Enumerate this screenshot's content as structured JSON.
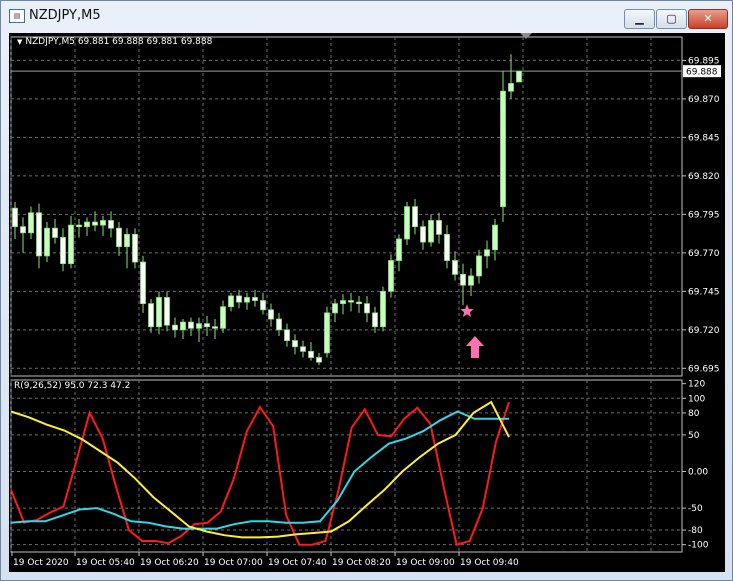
{
  "window": {
    "title": "NZDJPY,M5",
    "icon": "chart-window-icon",
    "controls": {
      "minimize": "▁",
      "maximize": "▢",
      "close": "✕"
    }
  },
  "main_chart": {
    "header": "NZDJPY,M5  69.881 69.888 69.881 69.888",
    "price_labels": [
      "69.895",
      "69.870",
      "69.845",
      "69.820",
      "69.795",
      "69.770",
      "69.745",
      "69.720",
      "69.695"
    ],
    "price_values": [
      69.895,
      69.87,
      69.845,
      69.82,
      69.795,
      69.77,
      69.745,
      69.72,
      69.695
    ],
    "current_price": "69.888",
    "current_price_value": 69.888,
    "colors": {
      "background": "#000000",
      "grid": "#6b6b6b",
      "bull_candle": "#c8ffc0",
      "bear_candle": "#ffffff",
      "wick": "#8ddf7a",
      "arrow": "#ff70b0",
      "star": "#ff70b0"
    },
    "candles": [
      [
        69.799,
        69.803,
        69.779,
        69.787
      ],
      [
        69.787,
        69.793,
        69.77,
        69.783
      ],
      [
        69.783,
        69.8,
        69.779,
        69.796
      ],
      [
        69.796,
        69.802,
        69.76,
        69.768
      ],
      [
        69.768,
        69.79,
        69.764,
        69.786
      ],
      [
        69.786,
        69.792,
        69.776,
        69.78
      ],
      [
        69.78,
        69.786,
        69.758,
        69.763
      ],
      [
        69.763,
        69.794,
        69.76,
        69.788
      ],
      [
        69.788,
        69.792,
        69.78,
        69.787
      ],
      [
        69.787,
        69.793,
        69.781,
        69.79
      ],
      [
        69.79,
        69.797,
        69.784,
        69.788
      ],
      [
        69.788,
        69.794,
        69.781,
        69.791
      ],
      [
        69.791,
        69.797,
        69.78,
        69.786
      ],
      [
        69.786,
        69.79,
        69.768,
        69.774
      ],
      [
        69.774,
        69.786,
        69.76,
        69.782
      ],
      [
        69.782,
        69.786,
        69.76,
        69.764
      ],
      [
        69.764,
        69.768,
        69.731,
        69.737
      ],
      [
        69.737,
        69.74,
        69.718,
        69.722
      ],
      [
        69.722,
        69.745,
        69.717,
        69.741
      ],
      [
        69.741,
        69.745,
        69.719,
        69.723
      ],
      [
        69.723,
        69.728,
        69.715,
        69.72
      ],
      [
        69.72,
        69.727,
        69.714,
        69.725
      ],
      [
        69.725,
        69.728,
        69.716,
        69.721
      ],
      [
        69.721,
        69.728,
        69.712,
        69.724
      ],
      [
        69.724,
        69.729,
        69.716,
        69.722
      ],
      [
        69.722,
        69.727,
        69.714,
        69.721
      ],
      [
        69.721,
        69.739,
        69.718,
        69.735
      ],
      [
        69.735,
        69.744,
        69.732,
        69.742
      ],
      [
        69.742,
        69.746,
        69.734,
        69.738
      ],
      [
        69.738,
        69.744,
        69.733,
        69.741
      ],
      [
        69.741,
        69.746,
        69.735,
        69.739
      ],
      [
        69.739,
        69.744,
        69.73,
        69.733
      ],
      [
        69.733,
        69.737,
        69.722,
        69.727
      ],
      [
        69.727,
        69.731,
        69.716,
        69.72
      ],
      [
        69.72,
        69.724,
        69.709,
        69.713
      ],
      [
        69.713,
        69.717,
        69.704,
        69.709
      ],
      [
        69.709,
        69.713,
        69.702,
        69.706
      ],
      [
        69.706,
        69.712,
        69.7,
        69.702
      ],
      [
        69.702,
        69.705,
        69.697,
        69.699
      ],
      [
        69.705,
        69.735,
        69.702,
        69.731
      ],
      [
        69.731,
        69.74,
        69.725,
        69.737
      ],
      [
        69.737,
        69.743,
        69.73,
        69.739
      ],
      [
        69.739,
        69.744,
        69.732,
        69.738
      ],
      [
        69.738,
        69.742,
        69.731,
        69.737
      ],
      [
        69.737,
        69.742,
        69.725,
        69.731
      ],
      [
        69.731,
        69.735,
        69.718,
        69.722
      ],
      [
        69.722,
        69.748,
        69.719,
        69.745
      ],
      [
        69.745,
        69.769,
        69.741,
        69.765
      ],
      [
        69.765,
        69.782,
        69.758,
        69.779
      ],
      [
        69.779,
        69.803,
        69.775,
        69.8
      ],
      [
        69.8,
        69.805,
        69.782,
        69.787
      ],
      [
        69.787,
        69.791,
        69.772,
        69.777
      ],
      [
        69.777,
        69.795,
        69.774,
        69.791
      ],
      [
        69.791,
        69.796,
        69.776,
        69.782
      ],
      [
        69.782,
        69.788,
        69.76,
        69.765
      ],
      [
        69.765,
        69.771,
        69.752,
        69.756
      ],
      [
        69.756,
        69.763,
        69.736,
        69.749
      ],
      [
        69.749,
        69.76,
        69.742,
        69.755
      ],
      [
        69.755,
        69.772,
        69.75,
        69.768
      ],
      [
        69.768,
        69.778,
        69.76,
        69.772
      ],
      [
        69.772,
        69.792,
        69.765,
        69.788
      ],
      [
        69.8,
        69.888,
        69.79,
        69.875
      ],
      [
        69.875,
        69.899,
        69.87,
        69.88
      ],
      [
        69.881,
        69.888,
        69.881,
        69.888
      ]
    ],
    "markers": [
      {
        "type": "star",
        "icon": "star-icon",
        "index": 57,
        "price": 69.732
      },
      {
        "type": "arrow",
        "icon": "up-arrow-icon",
        "index": 58,
        "price": 69.716
      }
    ]
  },
  "indicator": {
    "header": "R(9,26,52) 95.0 72.3 47.2",
    "level_labels": [
      "120",
      "100",
      "80",
      "50",
      "0.00",
      "-50",
      "-80",
      "-100"
    ],
    "level_values": [
      120,
      100,
      80,
      50,
      0,
      -50,
      -80,
      -100
    ],
    "series": [
      {
        "color": "#ff1a1a",
        "values": [
          -25,
          -70,
          -66,
          -56,
          -48,
          15,
          80,
          45,
          -20,
          -80,
          -95,
          -95,
          -98,
          -88,
          -72,
          -70,
          -55,
          -10,
          55,
          88,
          62,
          -60,
          -100,
          -100,
          -95,
          -25,
          60,
          85,
          50,
          48,
          72,
          87,
          65,
          -20,
          -100,
          -95,
          -50,
          40,
          95
        ]
      },
      {
        "color": "#33d6e8",
        "values": [
          -70,
          -68,
          -68,
          -60,
          -52,
          -50,
          -58,
          -68,
          -70,
          -75,
          -78,
          -78,
          -78,
          -72,
          -68,
          -68,
          -70,
          -70,
          -68,
          -40,
          0,
          20,
          38,
          45,
          55,
          70,
          82,
          72,
          72,
          72
        ]
      },
      {
        "color": "#ffee33",
        "values": [
          82,
          74,
          64,
          56,
          44,
          28,
          12,
          -10,
          -35,
          -55,
          -75,
          -82,
          -87,
          -90,
          -90,
          -89,
          -86,
          -84,
          -82,
          -68,
          -46,
          -25,
          0,
          20,
          38,
          50,
          80,
          95,
          47
        ]
      }
    ]
  },
  "time_labels": [
    "19 Oct 2020",
    "19 Oct 05:40",
    "19 Oct 06:20",
    "19 Oct 07:00",
    "19 Oct 07:40",
    "19 Oct 08:20",
    "19 Oct 09:00",
    "19 Oct 09:40"
  ]
}
